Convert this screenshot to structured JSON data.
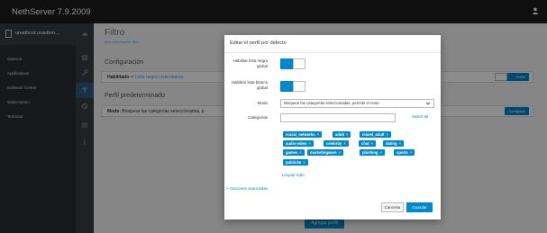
{
  "app": {
    "title": "NethServer 7.9.2009"
  },
  "sidebar": {
    "host": "unadhost.unadom...",
    "items": [
      {
        "label": "Sistema"
      },
      {
        "label": "Applications"
      },
      {
        "label": "Software Center"
      },
      {
        "label": "Subscription"
      },
      {
        "label": "Terminal"
      }
    ]
  },
  "rail": {
    "icons": [
      "cloud-icon",
      "grid-icon",
      "wrench-icon",
      "filter-icon",
      "ban-icon",
      "list-icon",
      "info-icon"
    ]
  },
  "main": {
    "title": "Filtro",
    "more_info": "Más información filtro",
    "config_section": "Configuración",
    "enabled_label": "Habilitado",
    "check_mark": "✔",
    "enabled_links": "Lista negra  Lista blanca",
    "edit_button": "Editar",
    "profile_section": "Perfil predeterminado",
    "mode_label": "Modo:",
    "mode_value": "Bloquear las categorías seleccionadas, p",
    "configure_button": "Configurar",
    "add_profile_button": "Agregar perfil"
  },
  "modal": {
    "title": "Editar el perfil por defecto",
    "blacklist_label": "Habilitar lista negra global",
    "whitelist_label": "Habilitar lista blanca global",
    "mode_label": "Modo",
    "mode_value": "Bloquear las categorías seleccionadas, permitir el resto",
    "categories_label": "Categorías",
    "categories_input_value": "",
    "select_all": "Select all",
    "tags": [
      "social_networks",
      "adult",
      "mixed_adult",
      "audio-video",
      "celebrity",
      "chat",
      "dating",
      "games",
      "marketingware",
      "phishing",
      "sports",
      "publicite"
    ],
    "tag_remove": "×",
    "clear_all": "Limpiar todo",
    "advanced": "Opciones avanzadas",
    "advanced_chevron": ">",
    "cancel_button": "Cancelar",
    "save_button": "Guardar"
  },
  "colors": {
    "accent": "#0088ce",
    "topbar": "#1d1d1d",
    "sidebar": "#292e34"
  }
}
